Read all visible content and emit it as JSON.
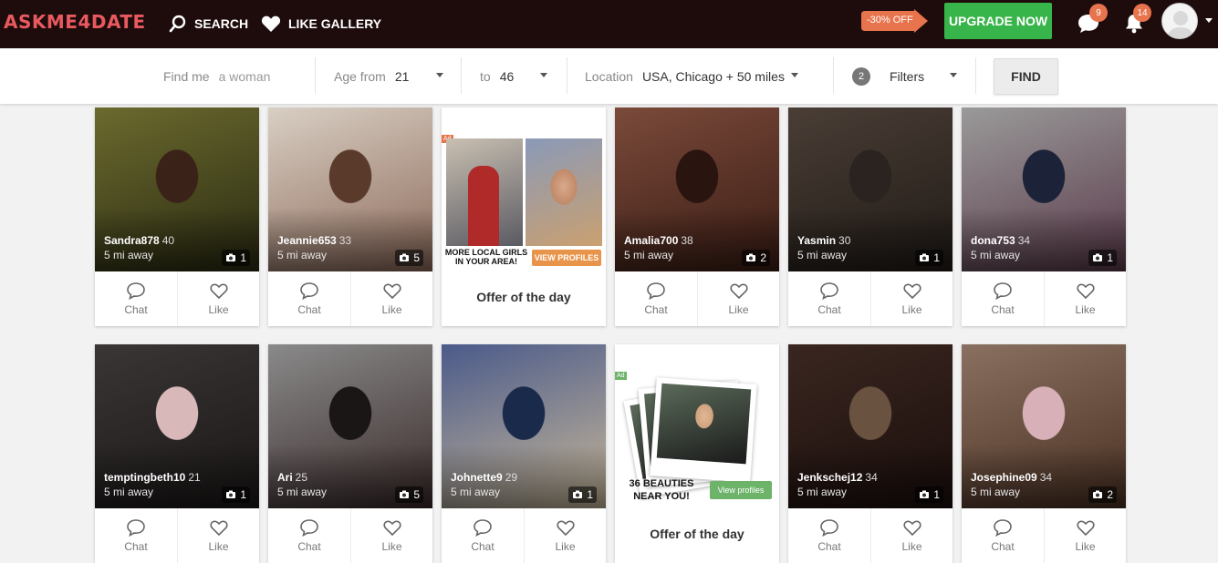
{
  "header": {
    "logo": "ASKME4DATE",
    "search_label": "SEARCH",
    "like_gallery_label": "LIKE GALLERY",
    "discount_label": "-30% OFF",
    "upgrade_label": "UPGRADE NOW",
    "messages_badge": "9",
    "notifications_badge": "14"
  },
  "filters": {
    "find_me_label": "Find me",
    "find_me_value": "a woman",
    "age_from_label": "Age from",
    "age_from_value": "21",
    "age_to_label": "to",
    "age_to_value": "46",
    "location_label": "Location",
    "location_value": "USA, Chicago + 50 miles",
    "filters_count": "2",
    "filters_label": "Filters",
    "find_button": "FIND"
  },
  "actions": {
    "chat": "Chat",
    "like": "Like"
  },
  "profiles": [
    {
      "name": "Sandra878",
      "age": "40",
      "distance": "5 mi away",
      "photos": "1"
    },
    {
      "name": "Jeannie653",
      "age": "33",
      "distance": "5 mi away",
      "photos": "5"
    },
    {
      "name": "Amalia700",
      "age": "38",
      "distance": "5 mi away",
      "photos": "2"
    },
    {
      "name": "Yasmin",
      "age": "30",
      "distance": "5 mi away",
      "photos": "1"
    },
    {
      "name": "dona753",
      "age": "34",
      "distance": "5 mi away",
      "photos": "1"
    },
    {
      "name": "temptingbeth10",
      "age": "21",
      "distance": "5 mi away",
      "photos": "1"
    },
    {
      "name": "Ari",
      "age": "25",
      "distance": "5 mi away",
      "photos": "5"
    },
    {
      "name": "Johnette9",
      "age": "29",
      "distance": "5 mi away",
      "photos": "1"
    },
    {
      "name": "Jenkschej12",
      "age": "34",
      "distance": "5 mi away",
      "photos": "1"
    },
    {
      "name": "Josephine09",
      "age": "34",
      "distance": "5 mi away",
      "photos": "2"
    }
  ],
  "ads": [
    {
      "label": "Ad",
      "caption": "MORE LOCAL GIRLS IN YOUR AREA!",
      "button": "VIEW PROFILES",
      "title": "Offer of the day"
    },
    {
      "label": "Ad",
      "caption_line1": "36 BEAUTIES",
      "caption_line2": "NEAR YOU!",
      "button": "View profiles",
      "title": "Offer of the day"
    }
  ],
  "colors": {
    "topbar": "#1e0b0b",
    "logo": "#e85a5f",
    "upgrade": "#38b54a",
    "badge": "#e8744e",
    "ad_button_orange": "#e8944a",
    "ad_button_green": "#6db36a"
  }
}
